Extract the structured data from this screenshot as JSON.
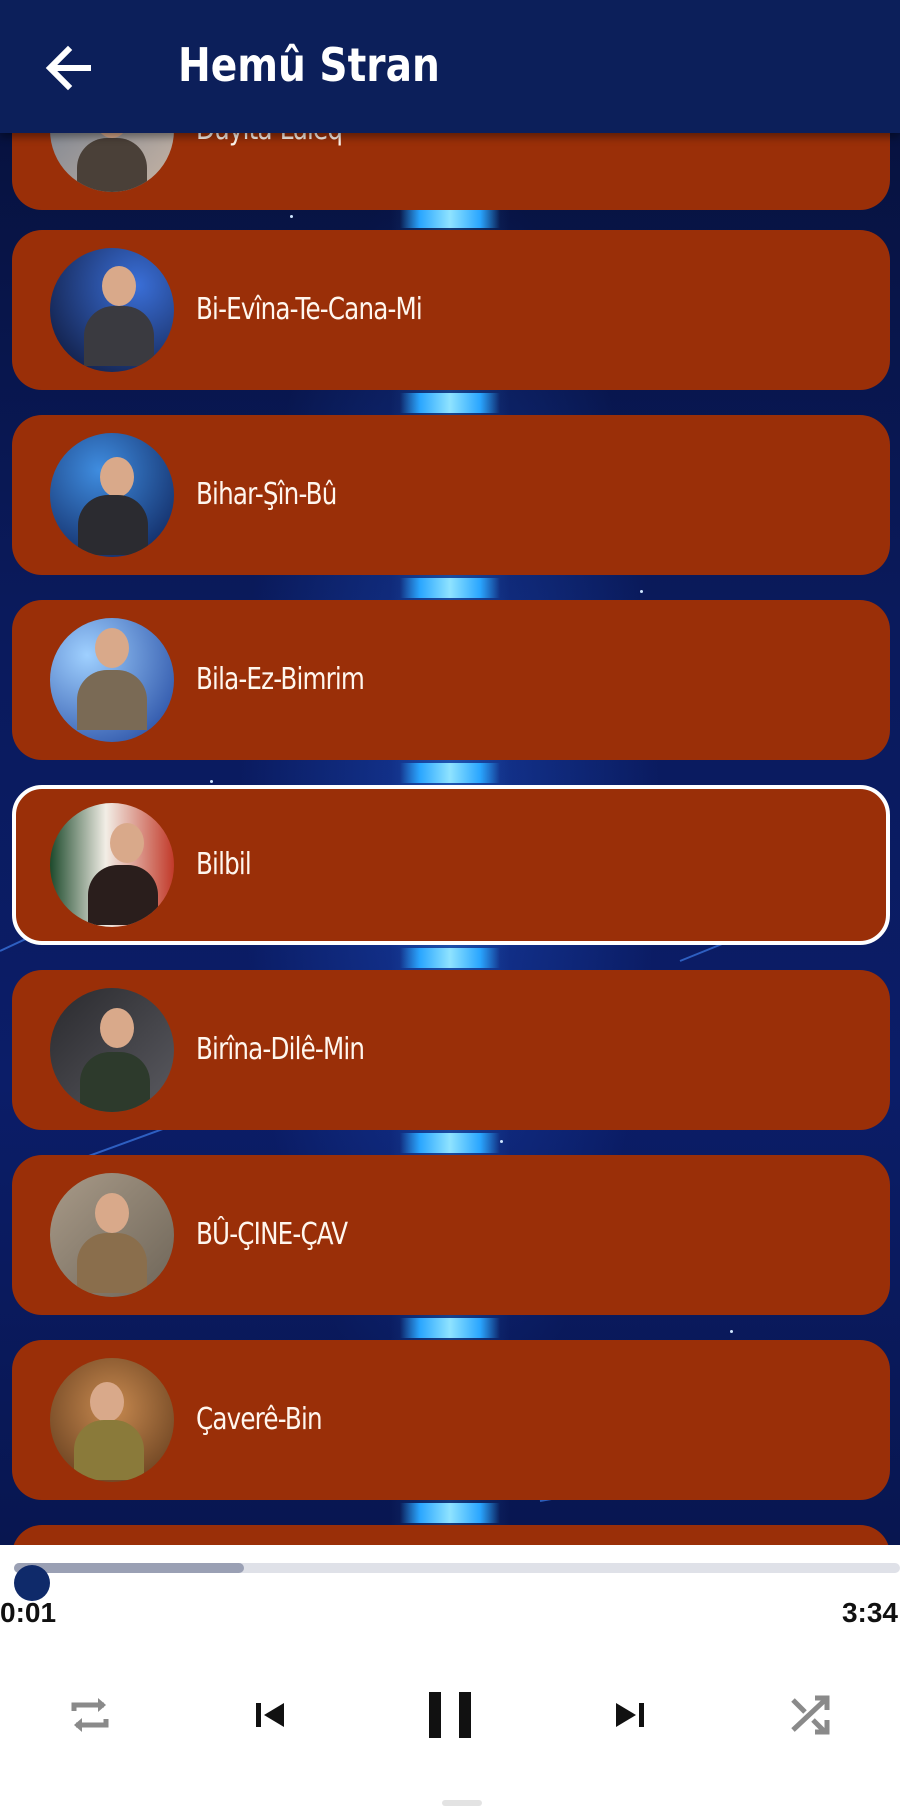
{
  "app_bar": {
    "title": "Hemû Stran",
    "back_icon": "arrow-left-icon"
  },
  "songs": [
    {
      "title": "Duyîta-Lûleq"
    },
    {
      "title": "Bi-Evîna-Te-Cana-Mi"
    },
    {
      "title": "Bihar-Şîn-Bû"
    },
    {
      "title": "Bila-Ez-Bimrim"
    },
    {
      "title": "Bilbil"
    },
    {
      "title": "Birîna-Dilê-Min"
    },
    {
      "title": "BÛ-ÇINE-ÇAV"
    },
    {
      "title": "Çaverê-Bin"
    }
  ],
  "active_song_index": 4,
  "player": {
    "elapsed": "0:01",
    "duration": "3:34",
    "progress_fraction": 0.005,
    "buffered_fraction": 0.26,
    "controls": [
      "repeat-icon",
      "skip-previous-icon",
      "pause-icon",
      "skip-next-icon",
      "shuffle-icon"
    ]
  },
  "colors": {
    "app_bar": "#0c1f5a",
    "card": "#9a2f08",
    "card_text": "#fff6ee",
    "seek_thumb": "#0f2a6a"
  }
}
